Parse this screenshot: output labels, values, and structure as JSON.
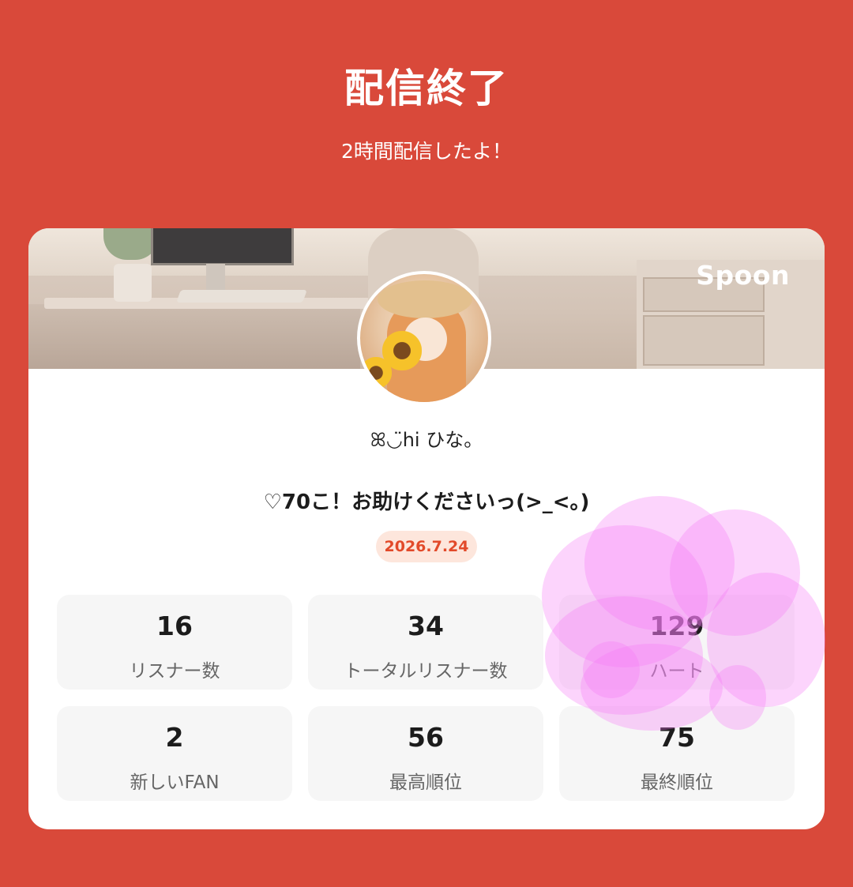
{
  "header": {
    "title": "配信終了",
    "subtitle": "2時間配信したよ！"
  },
  "card": {
    "brand": "Spoon",
    "username": "ꕤ◡̈hi ひな。",
    "stream_title": "♡70こ！お助けくださいっ(>_<。)",
    "date": "2026.7.24",
    "stats": [
      {
        "value": "16",
        "label": "リスナー数"
      },
      {
        "value": "34",
        "label": "トータルリスナー数"
      },
      {
        "value": "129",
        "label": "ハート"
      },
      {
        "value": "2",
        "label": "新しいFAN"
      },
      {
        "value": "56",
        "label": "最高順位"
      },
      {
        "value": "75",
        "label": "最終順位"
      }
    ]
  },
  "colors": {
    "background": "#d9493a",
    "card": "#ffffff",
    "stat_box": "#f6f6f6",
    "date_text": "#e24a2a",
    "date_badge": "#fde6dc",
    "scribble": "#f578f5"
  }
}
